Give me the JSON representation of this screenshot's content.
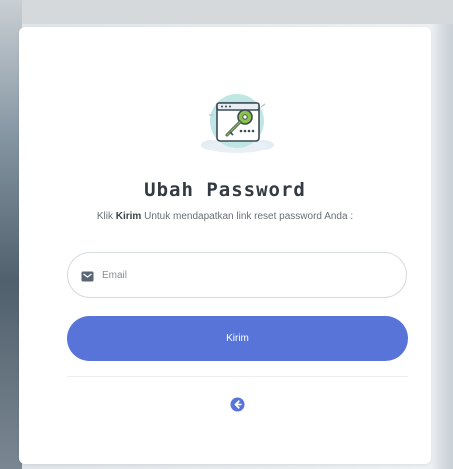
{
  "form": {
    "title": "Ubah Password",
    "subtitle_prefix": "Klik ",
    "subtitle_bold": "Kirim",
    "subtitle_suffix": " Untuk mendapatkan link reset password Anda :",
    "email_placeholder": "Email",
    "email_value": "",
    "submit_label": "Kirim"
  },
  "icons": {
    "illustration": "key-lock-window-illustration",
    "email": "envelope-icon",
    "back": "arrow-left-circle-icon"
  },
  "colors": {
    "accent": "#5974d9",
    "card": "#ffffff",
    "title": "#333a42"
  }
}
